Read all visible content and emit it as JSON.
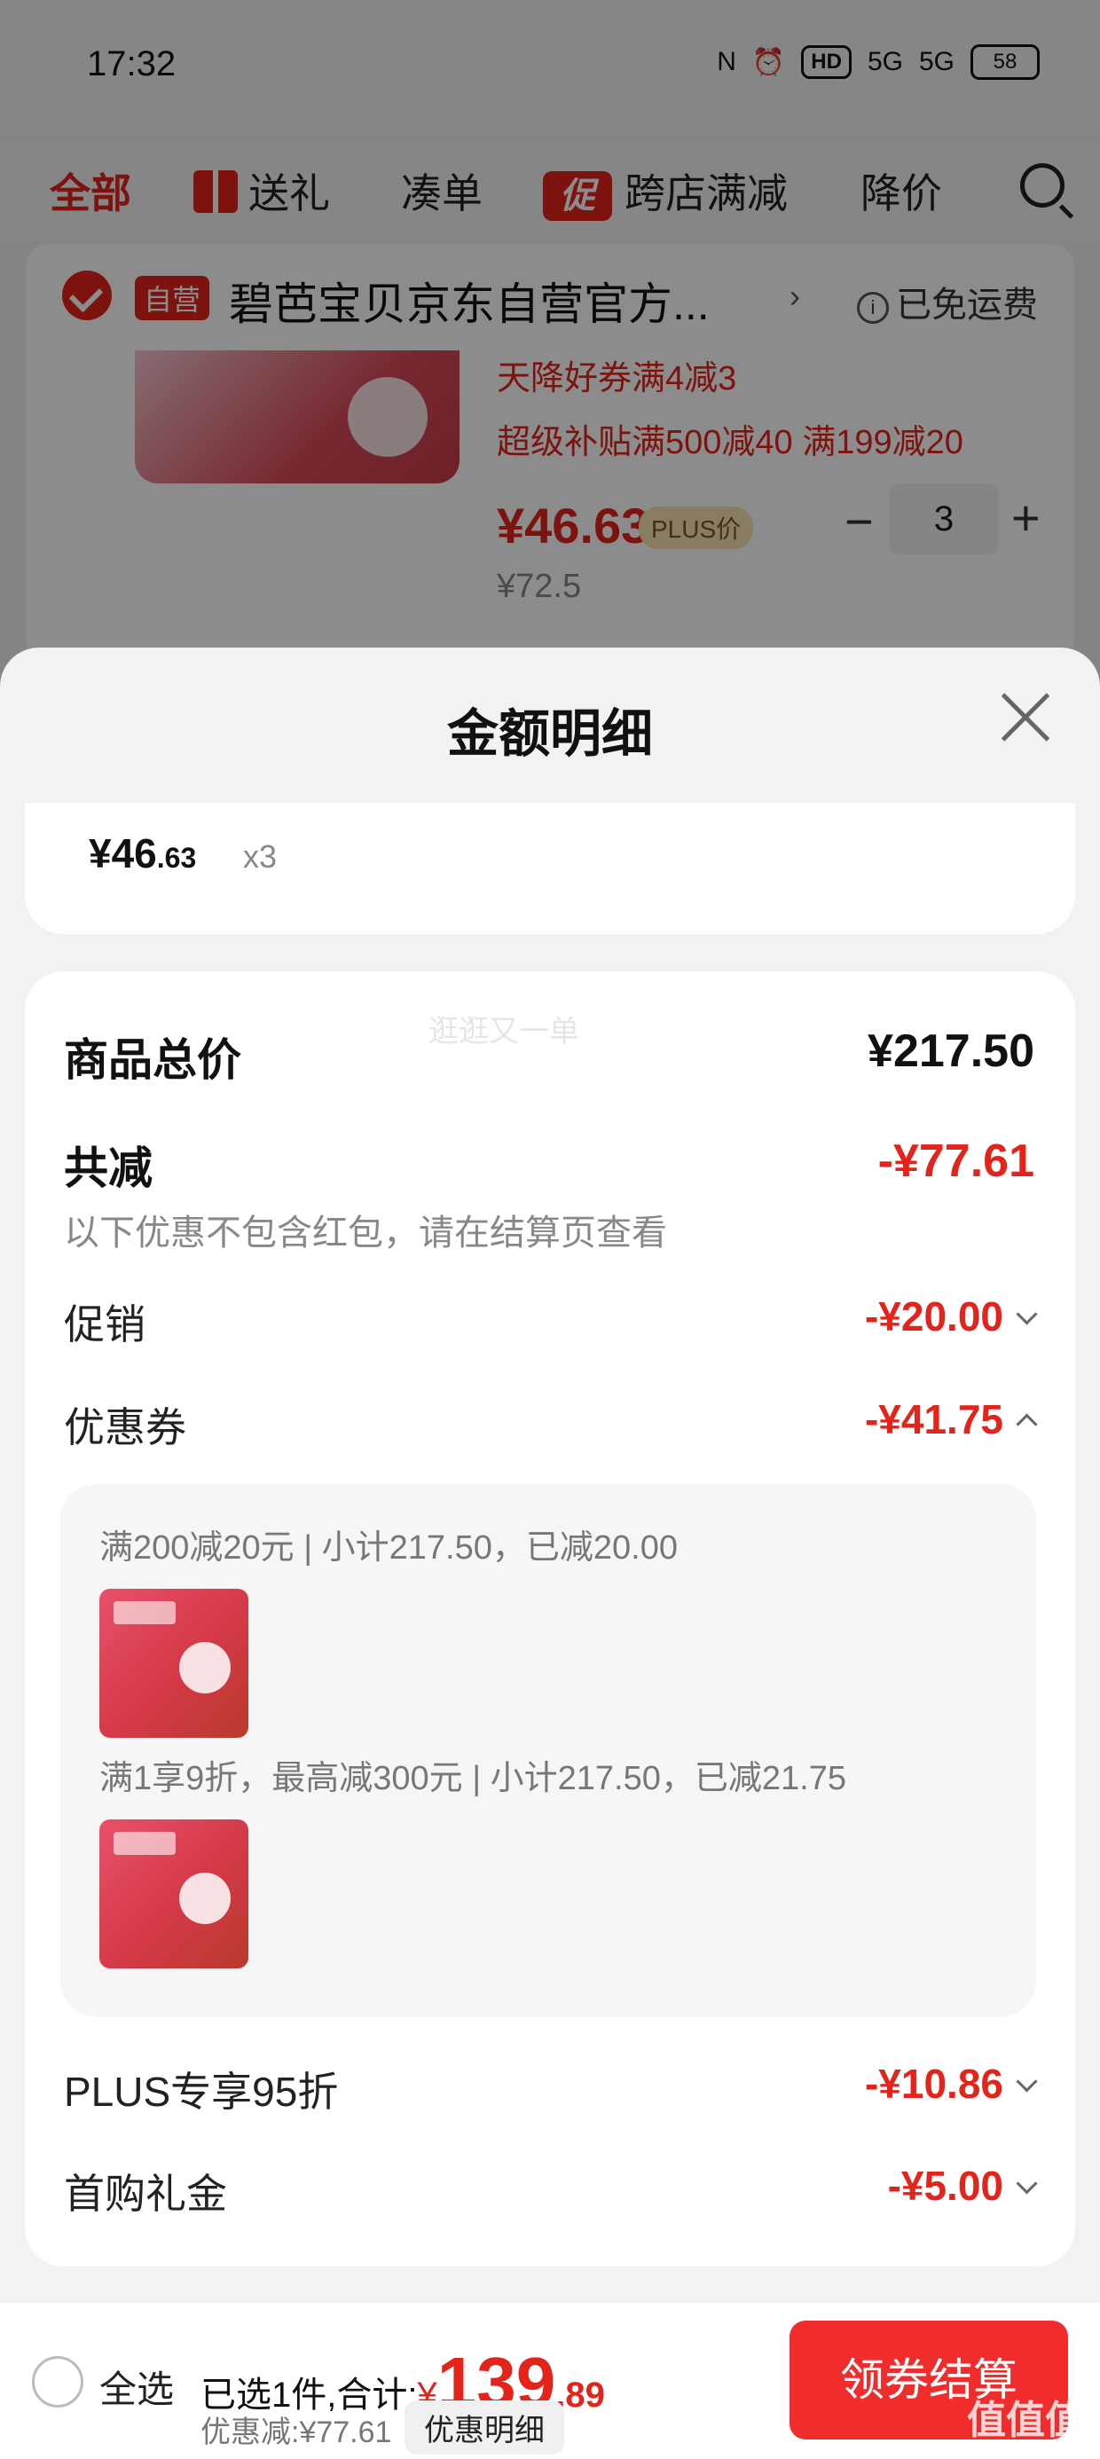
{
  "status_bar": {
    "time": "17:32",
    "signal1": "5G",
    "signal2": "5G",
    "hd": "HD",
    "battery": "58"
  },
  "tabs": {
    "all": "全部",
    "gift": "送礼",
    "bundle": "凑单",
    "promo_icon": "促",
    "cross_store": "跨店满减",
    "price_drop": "降价"
  },
  "store": {
    "badge": "自营",
    "name": "碧芭宝贝京东自营官方...",
    "free_shipping": "已免运费"
  },
  "product": {
    "coupon1": "天降好券满4减3",
    "coupon2": "超级补贴满500减40  满199减20",
    "price": "¥46.63",
    "plus_tag": "PLUS价",
    "original_price": "¥72.5",
    "quantity": "3"
  },
  "sheet": {
    "title": "金额明细",
    "unit_price_int": "¥46",
    "unit_price_dec": ".63",
    "unit_qty": "x3",
    "total_label": "商品总价",
    "total_value": "¥217.50",
    "reduce_label": "共减",
    "reduce_value": "-¥77.61",
    "note": "以下优惠不包含红包，请在结算页查看",
    "watermark": "逛逛又一单",
    "promo_label": "促销",
    "promo_value": "-¥20.00",
    "coupon_label": "优惠券",
    "coupon_value": "-¥41.75",
    "coupon_line1": "满200减20元 | 小计217.50，已减20.00",
    "coupon_line2": "满1享9折，最高减300元 | 小计217.50，已减21.75",
    "plus_label": "PLUS专享95折",
    "plus_value": "-¥10.86",
    "first_label": "首购礼金",
    "first_value": "-¥5.00"
  },
  "bottom_bar": {
    "select_all": "全选",
    "selected_text": "已选1件,合计:",
    "currency": "¥",
    "sum_int": "139",
    "sum_dec": ".89",
    "discount": "优惠减:¥77.61",
    "detail_button": "优惠明细",
    "checkout": "领券结算",
    "site_mark": "值值值"
  },
  "colors": {
    "accent": "#e4231a",
    "checkout": "#f12c2c"
  }
}
